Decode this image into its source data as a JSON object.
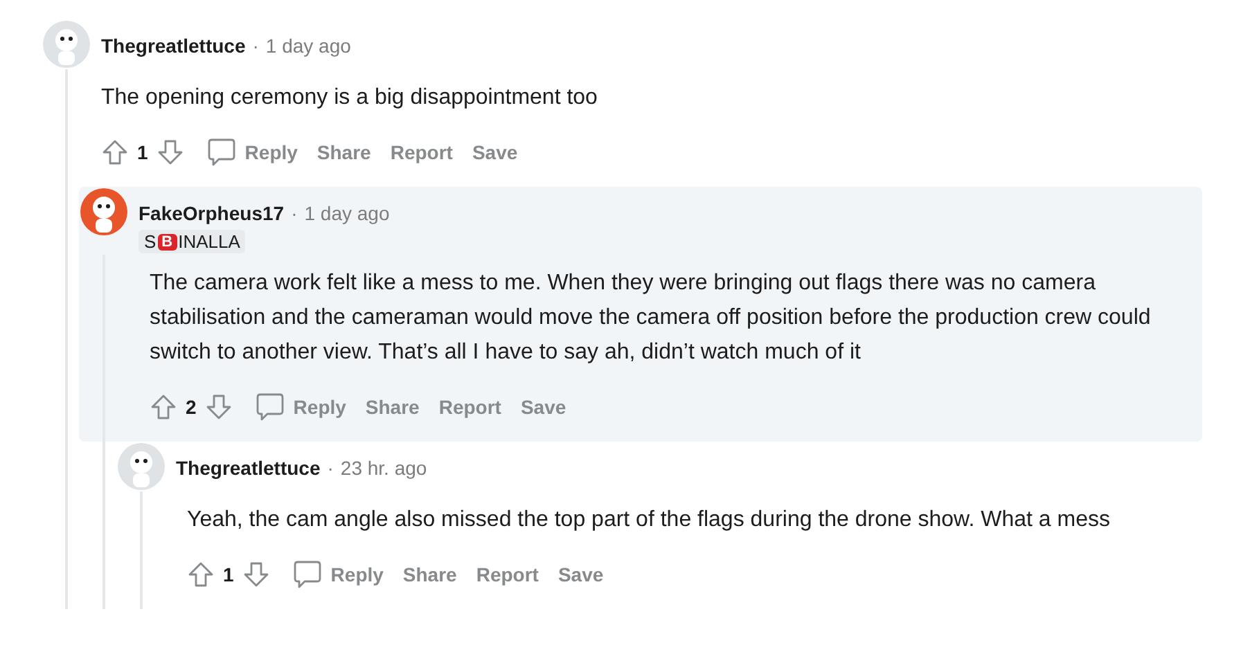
{
  "comments": [
    {
      "author": "Thegreatlettuce",
      "separator": "·",
      "time": "1 day ago",
      "color": "#dfe3e6",
      "highlighted": false,
      "body": "The opening ceremony is a big disappointment too",
      "score": "1",
      "actions": [
        "Reply",
        "Share",
        "Report",
        "Save"
      ],
      "children": [
        {
          "author": "FakeOrpheus17",
          "separator": "·",
          "time": "1 day ago",
          "color": "#e8552a",
          "highlighted": true,
          "flair": [
            {
              "kind": "text",
              "text": "S"
            },
            {
              "kind": "emoji",
              "text": "B"
            },
            {
              "kind": "text",
              "text": "INALLA"
            }
          ],
          "body": "The camera work felt like a mess to me. When they were bringing out flags there was no camera stabilisation and the cameraman would move the camera off position before the production crew could switch to another view. That’s all I have to say ah, didn’t watch much of it",
          "score": "2",
          "actions": [
            "Reply",
            "Share",
            "Report",
            "Save"
          ],
          "children": [
            {
              "author": "Thegreatlettuce",
              "separator": "·",
              "time": "23 hr. ago",
              "color": "#dfe3e6",
              "highlighted": false,
              "body": "Yeah, the cam angle also missed the top part of the flags during the drone show. What a mess",
              "score": "1",
              "actions": [
                "Reply",
                "Share",
                "Report",
                "Save"
              ]
            }
          ]
        }
      ]
    }
  ]
}
